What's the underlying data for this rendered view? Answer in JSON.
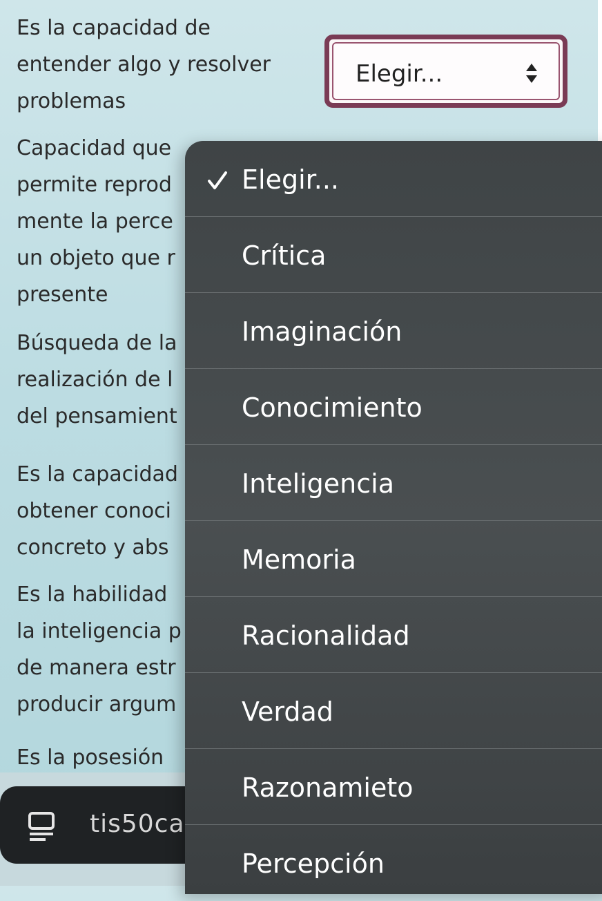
{
  "questions": [
    {
      "text": "Es la capacidad de\nentender algo y resolver\nproblemas"
    },
    {
      "text": "Capacidad que\npermite reprod\nmente la perce\nun objeto que r\npresente"
    },
    {
      "text": "Búsqueda de la\nrealización de l\ndel pensamient"
    },
    {
      "text": "Es la capacidad\nobtener conoci\nconcreto y abs"
    },
    {
      "text": "Es la habilidad\nla inteligencia p\nde manera estr\nproducir argum"
    },
    {
      "text": "Es la posesión"
    }
  ],
  "select": {
    "selected": "Elegir..."
  },
  "dropdown": {
    "options": [
      {
        "label": "Elegir...",
        "checked": true
      },
      {
        "label": "Crítica",
        "checked": false
      },
      {
        "label": "Imaginación",
        "checked": false
      },
      {
        "label": "Conocimiento",
        "checked": false
      },
      {
        "label": "Inteligencia",
        "checked": false
      },
      {
        "label": "Memoria",
        "checked": false
      },
      {
        "label": "Racionalidad",
        "checked": false
      },
      {
        "label": "Verdad",
        "checked": false
      },
      {
        "label": "Razonamieto",
        "checked": false
      },
      {
        "label": "Percepción",
        "checked": false
      }
    ]
  },
  "address_bar": {
    "text": "tis50ca",
    "icon": "tab-overview-icon"
  },
  "colors": {
    "select_border": "#7a3b55",
    "dropdown_bg": "#45494b",
    "page_bg": "#c2dee3"
  }
}
